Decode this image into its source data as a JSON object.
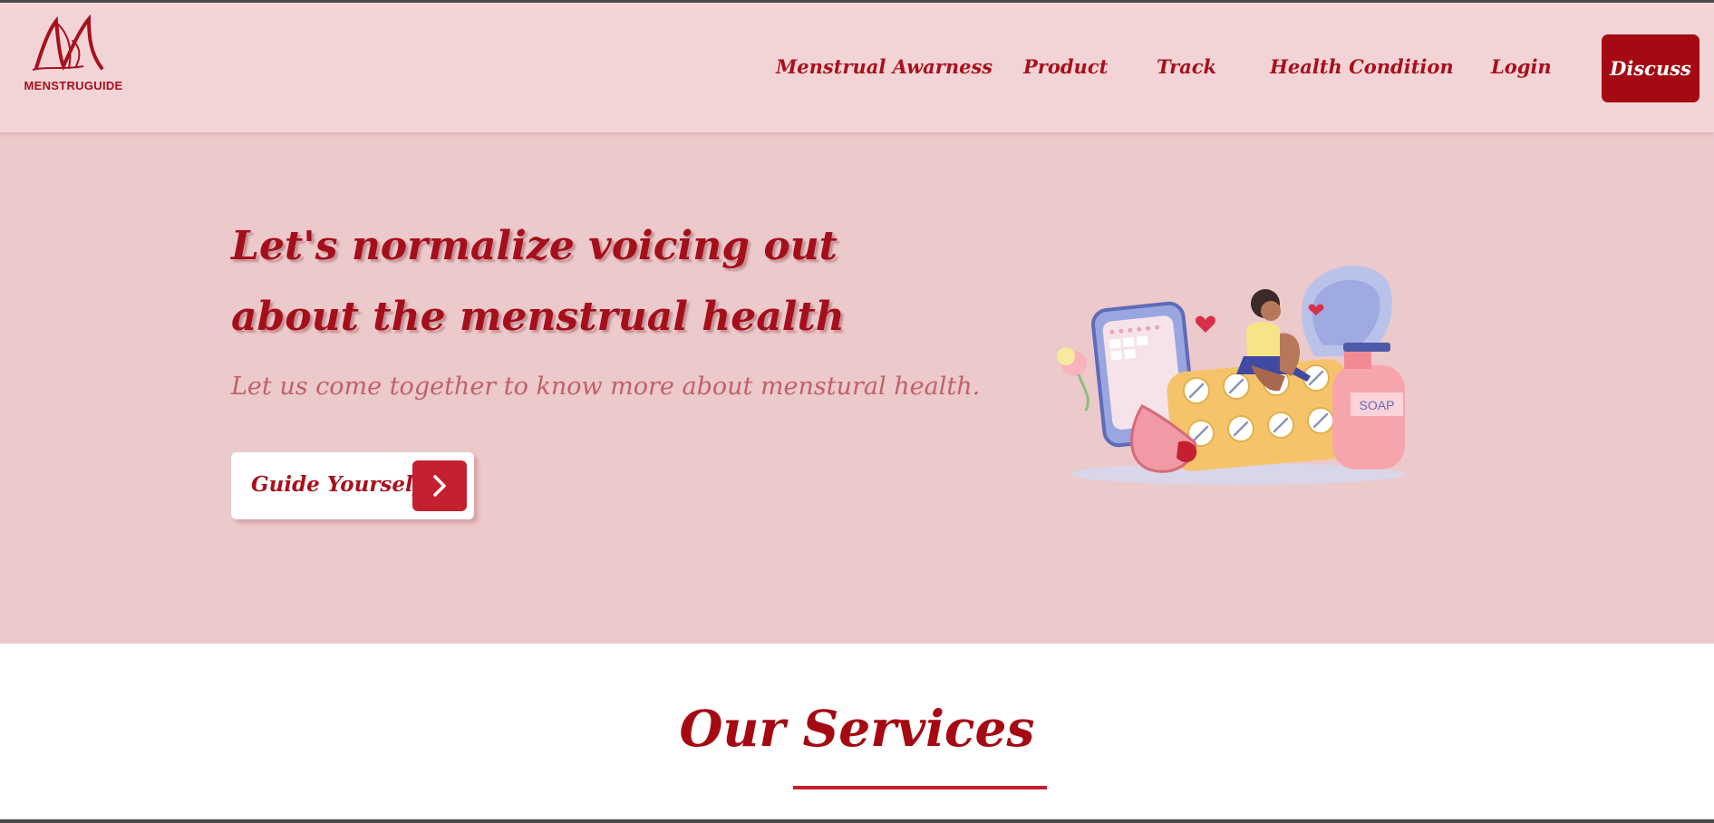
{
  "brand": {
    "name": "MENSTRUGUIDE",
    "logo_mark": "M"
  },
  "nav": {
    "links": [
      {
        "label": "Menstrual Awarness"
      },
      {
        "label": "Product"
      },
      {
        "label": "Track"
      },
      {
        "label": "Health Condition"
      },
      {
        "label": "Login"
      }
    ],
    "cta_label": "Discuss"
  },
  "hero": {
    "title": "Let's normalize voicing out about the menstrual health",
    "subtitle": "Let us come together to know more about menstural health.",
    "button_label": "Guide Yourself",
    "button_icon": "chevron-right-icon",
    "illustration_label": "SOAP"
  },
  "services": {
    "title": "Our Services"
  },
  "colors": {
    "nav_bg": "#f2d4d7",
    "hero_bg": "#ecc9ca",
    "primary": "#a50a12",
    "accent": "#c4202f",
    "subtitle": "#c0616a"
  }
}
